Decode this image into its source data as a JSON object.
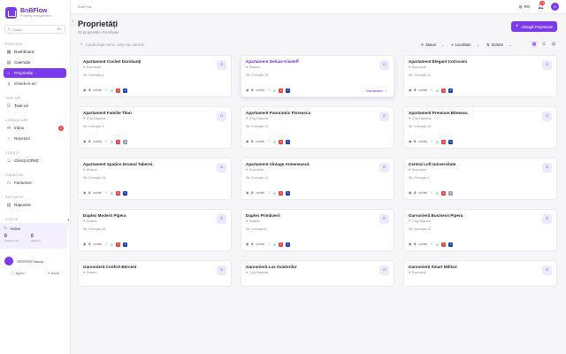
{
  "app": {
    "name": "BnBFlow",
    "tagline": "Property management"
  },
  "sidebar": {
    "search_placeholder": "Caută...",
    "search_kbd": "⌘K",
    "sections": {
      "principal": "PRINCIPAL",
      "taskuri": "TASK-URI",
      "comunicare": "COMUNICARE",
      "clienti": "CLIENȚI",
      "financiar": "FINANCIAR",
      "rapoarte": "RAPOARTE",
      "status": "STATUS"
    },
    "items": [
      {
        "label": "Dashboard",
        "icon": "grid-icon"
      },
      {
        "label": "Calendar",
        "icon": "calendar-icon"
      },
      {
        "label": "Proprietăți",
        "icon": "home-icon"
      },
      {
        "label": "Check-in-uri",
        "icon": "key-icon"
      },
      {
        "label": "Task-uri",
        "icon": "check-icon"
      },
      {
        "label": "Inbox",
        "icon": "inbox-icon",
        "badge": "3"
      },
      {
        "label": "Recenzii",
        "icon": "star-icon"
      },
      {
        "label": "Clienți (CRM)",
        "icon": "users-icon"
      },
      {
        "label": "Facturare",
        "icon": "invoice-icon"
      },
      {
        "label": "Rapoarte",
        "icon": "chart-icon"
      }
    ],
    "status": {
      "label": "Active",
      "a_num": "0",
      "a_lbl": "Check-in azi",
      "b_num": "0",
      "b_lbl": "Task-uri"
    },
    "user": {
      "name": "Demo"
    },
    "help": "Ajutor",
    "logout": "Ieșire"
  },
  "topbar": {
    "breadcrumb": "BnbFlow",
    "lang": "RO",
    "notif_count": "9+",
    "avatar_letter": "A"
  },
  "header": {
    "title": "Proprietăți",
    "subtitle": "25 proprietăți • 25 afișate",
    "add_label": "Adaugă Proprietate"
  },
  "filters": {
    "search_placeholder": "Caută după nume, oraș sau adresă...",
    "status": "Status",
    "location": "Localitate",
    "sort": "Sortare"
  },
  "card_labels": {
    "units_suffix": "unități",
    "view": "Vizualizare"
  },
  "properties": [
    {
      "title": "Apartament Cochet Dorobanți",
      "city": "București",
      "address": "Str. Exemplu 8",
      "units": "0",
      "flags": "rb"
    },
    {
      "title": "Apartament Deluxe Kiseleff",
      "city": "Brașov",
      "address": "Str. Exemplu 24",
      "units": "0",
      "flags": "rb",
      "hover": "true"
    },
    {
      "title": "Apartament Elegant Cotroceni",
      "city": "București",
      "address": "Str. Exemplu 12",
      "units": "0",
      "flags": "rb"
    },
    {
      "title": "Apartament Familie Titan",
      "city": "Cluj-Napoca",
      "address": "Str. Exemplu 3",
      "units": "0",
      "flags": "rg"
    },
    {
      "title": "Apartament Panoramic Floreasca",
      "city": "Cluj-Napoca",
      "address": "Str. Exemplu 11",
      "units": "0",
      "flags": "rb"
    },
    {
      "title": "Apartament Premium Băneasa",
      "city": "Cluj-Napoca",
      "address": "Str. Exemplu 16",
      "units": "0",
      "flags": "rb"
    },
    {
      "title": "Apartament Spațios Drumul Taberei",
      "city": "Brașov",
      "address": "Str. Exemplu 21",
      "units": "0",
      "flags": "rb"
    },
    {
      "title": "Apartament Vintage Armenească",
      "city": "București",
      "address": "Str. Exemplu 13",
      "units": "0",
      "flags": "rb"
    },
    {
      "title": "Central Loft Universitate",
      "city": "București",
      "address": "Str. Exemplu 1",
      "units": "0",
      "flags": "rg"
    },
    {
      "title": "Duplex Modern Pipera",
      "city": "Brașov",
      "address": "Str. Exemplu 18",
      "units": "0",
      "flags": "rb"
    },
    {
      "title": "Duplex Primăverii",
      "city": "Brașov",
      "address": "Str. Exemplu 6",
      "units": "0",
      "flags": "rb"
    },
    {
      "title": "Garsonieră Business Pipera",
      "city": "Cluj-Napoca",
      "address": "Str. Exemplu 22",
      "units": "0",
      "flags": "rb"
    },
    {
      "title": "Garsonieră Confort Berceni",
      "city": "Brașov",
      "address": "",
      "units": "",
      "flags": ""
    },
    {
      "title": "Garsonieră Lux Aviatorilor",
      "city": "Cluj-Napoca",
      "address": "",
      "units": "",
      "flags": ""
    },
    {
      "title": "Garsonieră Smart Militari",
      "city": "București",
      "address": "",
      "units": "",
      "flags": ""
    }
  ]
}
